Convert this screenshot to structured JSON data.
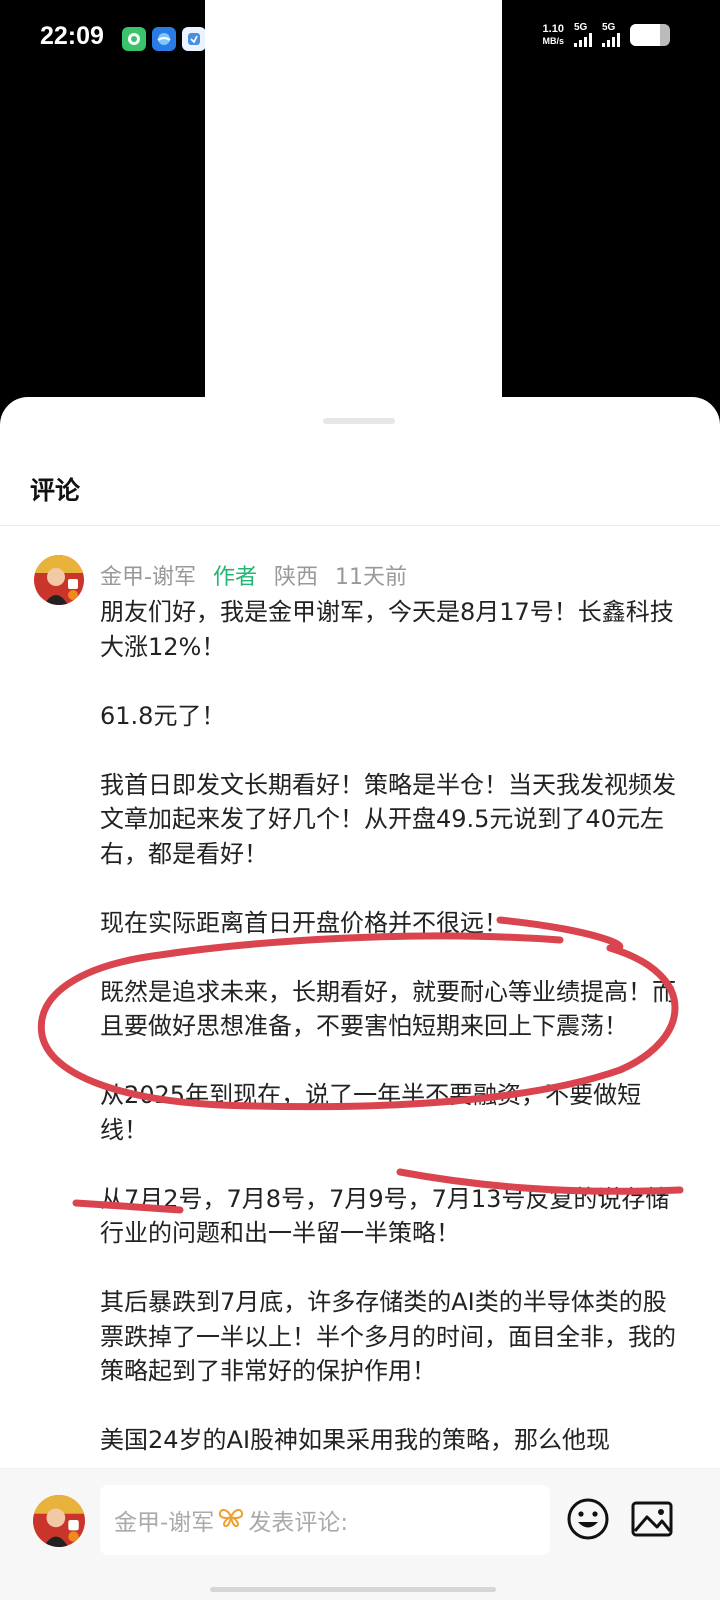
{
  "status_bar": {
    "time": "22:09",
    "net_speed_value": "1.10",
    "net_speed_unit": "MB/s",
    "signal1_label": "5G",
    "signal2_label": "5G",
    "battery_level": 0.75,
    "app_icons": [
      "chat-bubble-icon",
      "blue-app-icon",
      "note-app-icon",
      "location-pin-icon",
      "hand-app-icon"
    ]
  },
  "sheet": {
    "title": "评论"
  },
  "comment": {
    "author": "金甲-谢军",
    "badge": "作者",
    "location": "陕西",
    "time_ago": "11天前",
    "paragraphs": [
      "朋友们好，我是金甲谢军，今天是8月17号！长鑫科技大涨12%！",
      "61.8元了！",
      "我首日即发文长期看好！策略是半仓！当天我发视频发文章加起来发了好几个！从开盘49.5元说到了40元左右，都是看好！",
      "现在实际距离首日开盘价格并不很远！",
      "既然是追求未来，长期看好，就要耐心等业绩提高！而且要做好思想准备，不要害怕短期来回上下震荡！",
      "从2025年到现在，说了一年半不要融资，不要做短线！",
      "从7月2号，7月8号，7月9号，7月13号反复的说存储行业的问题和出一半留一半策略！",
      "其后暴跌到7月底，许多存储类的AI类的半导体类的股票跌掉了一半以上！半个多月的时间，面目全非，我的策略起到了非常好的保护作用！",
      "美国24岁的AI股神如果采用我的策略，那么他现"
    ]
  },
  "bottom_bar": {
    "user_name": "金甲-谢军",
    "placeholder_suffix": "发表评论:"
  },
  "colors": {
    "author_badge": "#22b573",
    "annotation_red": "#d9444e"
  }
}
